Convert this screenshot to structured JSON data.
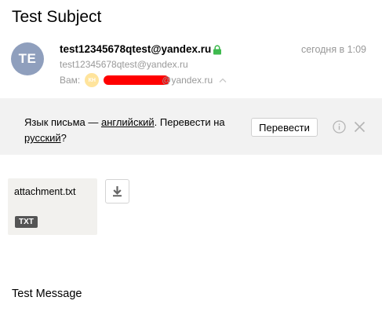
{
  "subject": "Test Subject",
  "sender": {
    "avatar_initials": "TE",
    "name": "test12345678qtest@yandex.ru",
    "email": "test12345678qtest@yandex.ru",
    "date": "сегодня в 1:09"
  },
  "recipients": {
    "label": "Вам:",
    "avatar_initials": "КН",
    "domain": "@yandex.ru"
  },
  "translate": {
    "text_before": "Язык письма — ",
    "source_language": "английский",
    "text_middle": ". Перевести на ",
    "target_language": "русский",
    "text_after": "?",
    "button_label": "Перевести"
  },
  "attachment": {
    "filename": "attachment.txt",
    "type_badge": "TXT"
  },
  "body": {
    "text": "Test Message"
  },
  "colors": {
    "avatar_bg": "#8f9fbd",
    "lock_green": "#3fba4f",
    "redaction": "#ff0000",
    "translate_bar_bg": "#f2f2f2"
  }
}
